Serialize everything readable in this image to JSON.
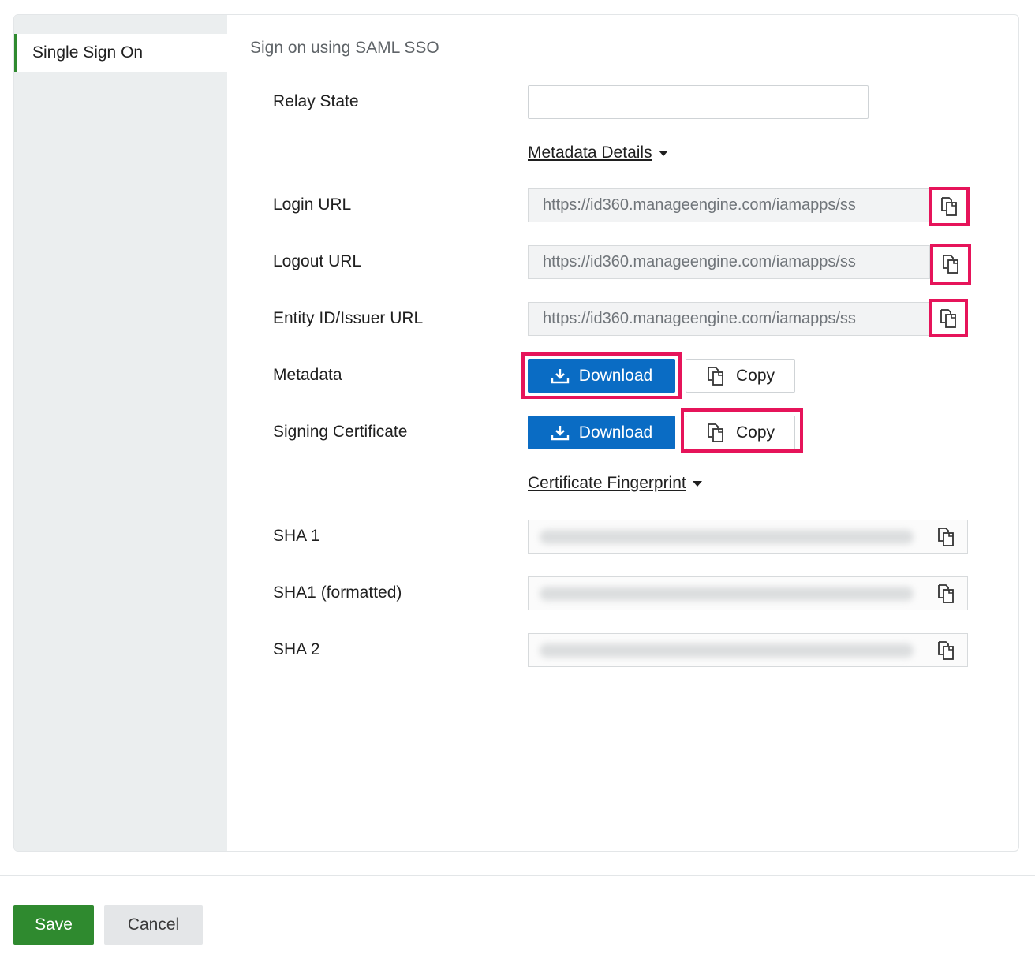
{
  "sidebar": {
    "items": [
      {
        "label": "Single Sign On"
      }
    ]
  },
  "form": {
    "section_title": "Sign on using SAML SSO",
    "relay_state": {
      "label": "Relay State",
      "value": ""
    },
    "metadata_details_toggle": "Metadata Details",
    "login_url": {
      "label": "Login URL",
      "value": "https://id360.manageengine.com/iamapps/ss"
    },
    "logout_url": {
      "label": "Logout URL",
      "value": "https://id360.manageengine.com/iamapps/ss"
    },
    "entity_id": {
      "label": "Entity ID/Issuer URL",
      "value": "https://id360.manageengine.com/iamapps/ss"
    },
    "metadata": {
      "label": "Metadata",
      "download_label": "Download",
      "copy_label": "Copy"
    },
    "signing_certificate": {
      "label": "Signing Certificate",
      "download_label": "Download",
      "copy_label": "Copy"
    },
    "certificate_fingerprint_toggle": "Certificate Fingerprint",
    "sha1": {
      "label": "SHA 1"
    },
    "sha1_formatted": {
      "label": "SHA1 (formatted)"
    },
    "sha2": {
      "label": "SHA 2"
    }
  },
  "footer": {
    "save_label": "Save",
    "cancel_label": "Cancel"
  },
  "colors": {
    "primary_blue": "#0a6cc4",
    "save_green": "#2f8a2f",
    "highlight_red": "#e6145a"
  },
  "icons": {
    "copy": "copy-icon",
    "download": "download-icon",
    "caret": "caret-down-icon"
  }
}
